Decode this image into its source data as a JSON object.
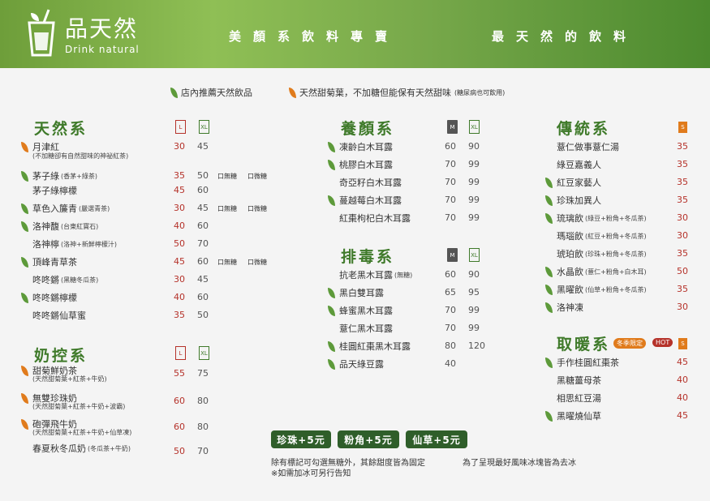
{
  "header": {
    "brand": "品天然",
    "brand_sub": "Drink natural",
    "slogan_left": "美顏系飲料專賣",
    "slogan_right": "最天然的飲料"
  },
  "legend": {
    "green_note": "店內推薦天然飲品",
    "orange_note": "天然甜菊葉，不加糖但能保有天然甜味",
    "orange_small": "(糖尿病也可飲用)"
  },
  "opts": {
    "no_ice": "口無糖",
    "less_sugar": "口微糖"
  },
  "colors": {
    "brand_green": "#3f7a2a",
    "price_red": "#b5322a",
    "accent_orange": "#e07b1c"
  },
  "sections": {
    "natural": {
      "title": "天然系",
      "size_a": "L",
      "size_b": "XL",
      "items": [
        {
          "leaf": "orange",
          "name": "月津紅",
          "desc": "",
          "p1": "30",
          "p2": "45",
          "opts": false
        },
        {
          "leaf": "green",
          "name": "茅子綠",
          "desc": "(香茅+綠茶)",
          "p1": "35",
          "p2": "50",
          "opts": true
        },
        {
          "leaf": "",
          "name": "茅子綠檸檬",
          "desc": "",
          "p1": "45",
          "p2": "60",
          "opts": false
        },
        {
          "leaf": "green",
          "name": "草色入簾青",
          "desc": "(嚴選青茶)",
          "p1": "30",
          "p2": "45",
          "opts": true
        },
        {
          "leaf": "green",
          "name": "洛神馥",
          "desc": "(台東紅寶石)",
          "p1": "40",
          "p2": "60",
          "opts": false
        },
        {
          "leaf": "",
          "name": "洛神檸",
          "desc": "(洛神+新鮮檸檬汁)",
          "p1": "50",
          "p2": "70",
          "opts": false
        },
        {
          "leaf": "green",
          "name": "頂峰青草茶",
          "desc": "",
          "p1": "45",
          "p2": "60",
          "opts": true
        },
        {
          "leaf": "",
          "name": "咚咚鏘",
          "desc": "(黑糖冬瓜茶)",
          "p1": "30",
          "p2": "45",
          "opts": false
        },
        {
          "leaf": "green",
          "name": "咚咚鏘檸檬",
          "desc": "",
          "p1": "40",
          "p2": "60",
          "opts": false
        },
        {
          "leaf": "",
          "name": "咚咚鏘仙草蜜",
          "desc": "",
          "p1": "35",
          "p2": "50",
          "opts": false
        }
      ],
      "yuejin_sub": "(不加糖卻有自然甜味的神祕紅茶)"
    },
    "milk": {
      "title": "奶控系",
      "size_a": "L",
      "size_b": "XL",
      "items": [
        {
          "leaf": "orange",
          "name": "甜菊鮮奶茶",
          "sub": "(天然甜菊葉+紅茶+牛奶)",
          "p1": "55",
          "p2": "75"
        },
        {
          "leaf": "orange",
          "name": "無雙珍珠奶",
          "sub": "(天然甜菊葉+紅茶+牛奶+波霸)",
          "p1": "60",
          "p2": "80"
        },
        {
          "leaf": "orange",
          "name": "砲彈飛牛奶",
          "sub": "(天然甜菊葉+紅茶+牛奶+仙草凍)",
          "p1": "60",
          "p2": "80"
        },
        {
          "leaf": "",
          "name": "春夏秋冬瓜奶",
          "sub": "(冬瓜茶+牛奶)",
          "p1": "50",
          "p2": "70"
        }
      ]
    },
    "beauty": {
      "title": "養顏系",
      "size_a": "M",
      "size_b": "XL",
      "items": [
        {
          "leaf": "green",
          "name": "凍齡白木耳露",
          "desc": "",
          "p1": "60",
          "p2": "90"
        },
        {
          "leaf": "green",
          "name": "桃膠白木耳露",
          "desc": "",
          "p1": "70",
          "p2": "99"
        },
        {
          "leaf": "",
          "name": "奇亞籽白木耳露",
          "desc": "",
          "p1": "70",
          "p2": "99"
        },
        {
          "leaf": "green",
          "name": "蔓越莓白木耳露",
          "desc": "",
          "p1": "70",
          "p2": "99"
        },
        {
          "leaf": "",
          "name": "紅棗枸杞白木耳露",
          "desc": "",
          "p1": "70",
          "p2": "99"
        }
      ]
    },
    "detox": {
      "title": "排毒系",
      "size_a": "M",
      "size_b": "XL",
      "items": [
        {
          "leaf": "",
          "name": "抗老黑木耳露",
          "desc": "(無糖)",
          "p1": "60",
          "p2": "90"
        },
        {
          "leaf": "green",
          "name": "黑白雙耳露",
          "desc": "",
          "p1": "65",
          "p2": "95"
        },
        {
          "leaf": "green",
          "name": "蜂蜜黑木耳露",
          "desc": "",
          "p1": "70",
          "p2": "99"
        },
        {
          "leaf": "",
          "name": "薏仁黑木耳露",
          "desc": "",
          "p1": "70",
          "p2": "99"
        },
        {
          "leaf": "green",
          "name": "桂圓紅棗黑木耳露",
          "desc": "",
          "p1": "80",
          "p2": "120"
        },
        {
          "leaf": "green",
          "name": "品天綠豆露",
          "desc": "",
          "p1": "40",
          "p2": ""
        }
      ]
    },
    "traditional": {
      "title": "傳統系",
      "size": "S",
      "items": [
        {
          "leaf": "",
          "name": "薏仁做事薏仁湯",
          "desc": "",
          "p": "35"
        },
        {
          "leaf": "",
          "name": "綠豆嘉義人",
          "desc": "",
          "p": "35"
        },
        {
          "leaf": "green",
          "name": "紅豆家藝人",
          "desc": "",
          "p": "35"
        },
        {
          "leaf": "green",
          "name": "珍珠加異人",
          "desc": "",
          "p": "35"
        },
        {
          "leaf": "green",
          "name": "琉璃飲",
          "desc": "(綠豆+粉角+冬瓜茶)",
          "p": "30"
        },
        {
          "leaf": "",
          "name": "瑪瑙飲",
          "desc": "(紅豆+粉角+冬瓜茶)",
          "p": "30"
        },
        {
          "leaf": "",
          "name": "琥珀飲",
          "desc": "(珍珠+粉角+冬瓜茶)",
          "p": "35"
        },
        {
          "leaf": "green",
          "name": "水晶飲",
          "desc": "(薏仁+粉角+白木耳)",
          "p": "50"
        },
        {
          "leaf": "green",
          "name": "黑曜飲",
          "desc": "(仙草+粉角+冬瓜茶)",
          "p": "35"
        },
        {
          "leaf": "green",
          "name": "洛神凍",
          "desc": "",
          "p": "30"
        }
      ]
    },
    "warm": {
      "title": "取暖系",
      "badge_winter": "冬季限定",
      "badge_hot": "HOT",
      "size": "S",
      "items": [
        {
          "leaf": "green",
          "name": "手作桂圓紅棗茶",
          "p": "45"
        },
        {
          "leaf": "",
          "name": "黑糖薑母茶",
          "p": "40"
        },
        {
          "leaf": "",
          "name": "相思紅豆湯",
          "p": "40"
        },
        {
          "leaf": "green",
          "name": "黑曜燒仙草",
          "p": "45"
        }
      ]
    }
  },
  "addons": [
    "珍珠+5元",
    "粉角+5元",
    "仙草+5元"
  ],
  "footer": {
    "line1a": "除有標記可勾選無糖外，其餘甜度皆為固定",
    "line1b": "為了呈現最好風味冰塊皆為去冰",
    "line2": "※如需加冰可另行告知"
  }
}
